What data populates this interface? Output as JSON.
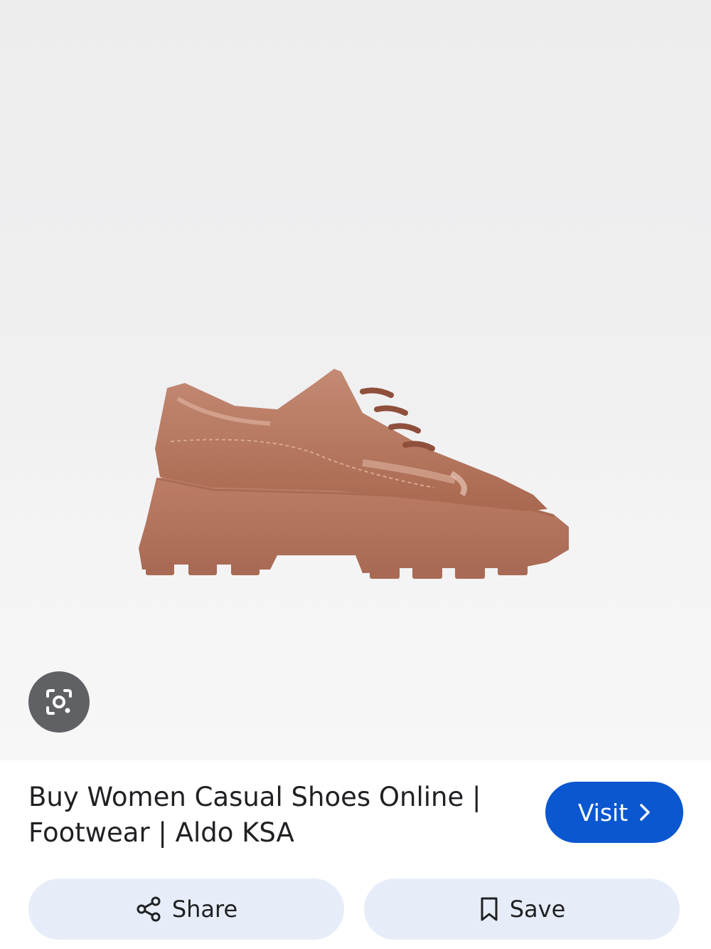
{
  "result": {
    "title_line1": "Buy Women Casual Shoes Online |",
    "title_line2": "Footwear | Aldo KSA"
  },
  "buttons": {
    "visit_label": "Visit",
    "share_label": "Share",
    "save_label": "Save"
  },
  "icons": {
    "lens": "google-lens-icon",
    "visit": "chevron-right-icon",
    "share": "share-icon",
    "save": "bookmark-icon"
  },
  "colors": {
    "visit_button": "#0b57d0",
    "action_button": "#e7edf8",
    "lens_button": "#5f6164",
    "shoe": "#b87a65"
  }
}
